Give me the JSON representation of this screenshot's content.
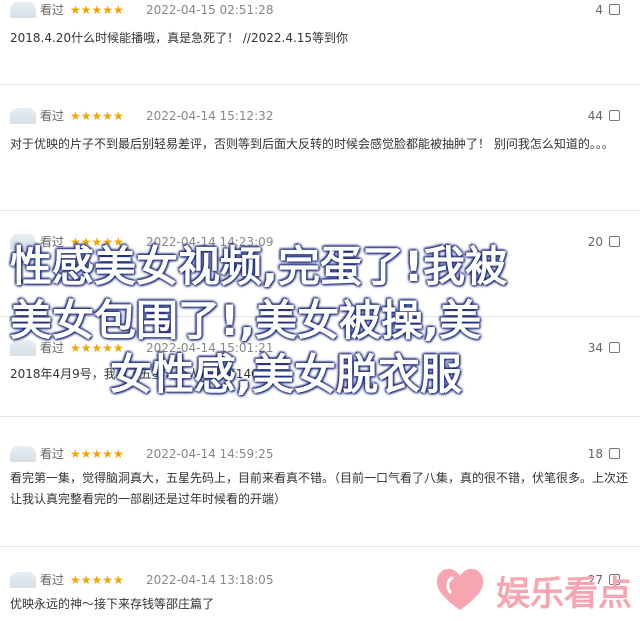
{
  "reviews": [
    {
      "status": "看过",
      "stars": "★★★★★",
      "date": "2022-04-15 02:51:28",
      "useful": "4",
      "text": "2018.4.20什么时候能播哦，真是急死了！ //2022.4.15等到你"
    },
    {
      "status": "看过",
      "stars": "★★★★★",
      "date": "2022-04-14 15:12:32",
      "useful": "44",
      "text": "对于优映的片子不到最后别轻易差评，否则等到后面大反转的时候会感觉脸都能被抽肿了！ 别问我怎么知道的。。。"
    },
    {
      "status": "看过",
      "stars": "★★★★★",
      "date": "2022-04-14 14:23:09",
      "useful": "20",
      "text": ""
    },
    {
      "status": "看过",
      "stars": "★★★★★",
      "date": "2022-04-14 15:01:21",
      "useful": "34",
      "text": "2018年4月9号，我看了五星，个人认真第1466个"
    },
    {
      "status": "看过",
      "stars": "★★★★★",
      "date": "2022-04-14 14:59:25",
      "useful": "18",
      "text": "看完第一集，觉得脑洞真大，五星先码上，目前来看真不错。（目前一口气看了八集，真的很不错，伏笔很多。上次还让我认真完整看完的一部剧还是过年时候看的开端）"
    },
    {
      "status": "看过",
      "stars": "★★★★★",
      "date": "2022-04-14 13:18:05",
      "useful": "27",
      "text": "优映永远的神～接下来存钱等邵庄篇了"
    }
  ],
  "overlay": {
    "line1": "性感美女视频,完蛋了!我被",
    "line2": "美女包围了!,美女被操,美",
    "line3": "女性感,美女脱衣服"
  },
  "watermark": {
    "text": "娱乐看点",
    "color": "#f7a5b0"
  },
  "colors": {
    "star": "#f2a400",
    "text": "#333333",
    "meta": "#666666",
    "divider": "#e6e6e6"
  }
}
